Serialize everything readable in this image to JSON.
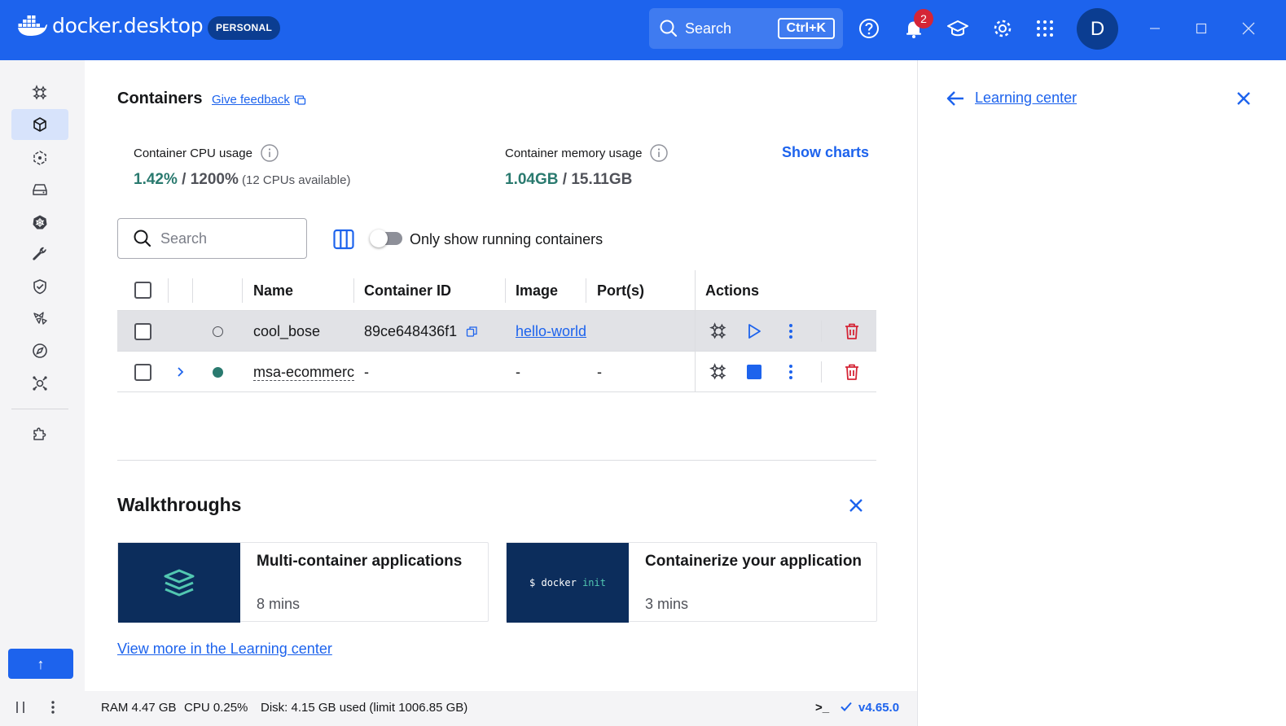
{
  "app": {
    "logo_text": "docker.desktop",
    "plan_badge": "PERSONAL",
    "search_label": "Search",
    "search_shortcut": "Ctrl+K",
    "notification_count": "2",
    "avatar_initial": "D",
    "accent_color": "#1d63ed"
  },
  "nav": {
    "items": [
      {
        "icon": "sparkle-icon",
        "active": false
      },
      {
        "icon": "containers-icon",
        "active": true
      },
      {
        "icon": "images-icon",
        "active": false
      },
      {
        "icon": "volumes-icon",
        "active": false
      },
      {
        "icon": "kubernetes-icon",
        "active": false
      },
      {
        "icon": "builds-icon",
        "active": false
      },
      {
        "icon": "scout-icon",
        "active": false
      },
      {
        "icon": "models-icon",
        "active": false
      },
      {
        "icon": "extensions-marketplace-icon",
        "active": false
      },
      {
        "icon": "mcp-toolkit-icon",
        "active": false
      },
      {
        "icon": "puzzle-icon",
        "active": false
      }
    ],
    "up_button": "↑"
  },
  "main": {
    "title": "Containers",
    "feedback_link": "Give feedback",
    "cpu": {
      "label": "Container CPU usage",
      "used": "1.42%",
      "sep": " / ",
      "total": "1200%",
      "note": " (12 CPUs available)"
    },
    "memory": {
      "label": "Container memory usage",
      "used": "1.04GB",
      "sep": " / ",
      "total": "15.11GB"
    },
    "show_charts": "Show charts",
    "search_placeholder": "Search",
    "toggle_label": "Only show running containers",
    "toggle_on": false,
    "table": {
      "columns": [
        "Name",
        "Container ID",
        "Image",
        "Port(s)",
        "Actions"
      ],
      "rows": [
        {
          "name": "cool_bose",
          "container_id": "89ce648436f1",
          "image": "hello-world",
          "ports": "",
          "status": "stopped",
          "status_color": "#505259"
        },
        {
          "name": "msa-ecommerc",
          "container_id": "-",
          "image": "-",
          "ports": "-",
          "status": "running",
          "status_color": "#2a7a6f"
        }
      ]
    },
    "walkthroughs": {
      "title": "Walkthroughs",
      "cards": [
        {
          "title": "Multi-container applications",
          "time": "8 mins"
        },
        {
          "title": "Containerize your application",
          "time": "3 mins",
          "code_prefix": "$ docker",
          "code_keyword": "init"
        }
      ],
      "view_more": "View more in the Learning center"
    }
  },
  "right_panel": {
    "title": "Learning center"
  },
  "footer": {
    "ram": "RAM 4.47 GB",
    "cpu": "CPU 0.25%",
    "disk": "Disk: 4.15 GB used (limit 1006.85 GB)",
    "terminal": ">_",
    "version": "v4.65.0"
  }
}
